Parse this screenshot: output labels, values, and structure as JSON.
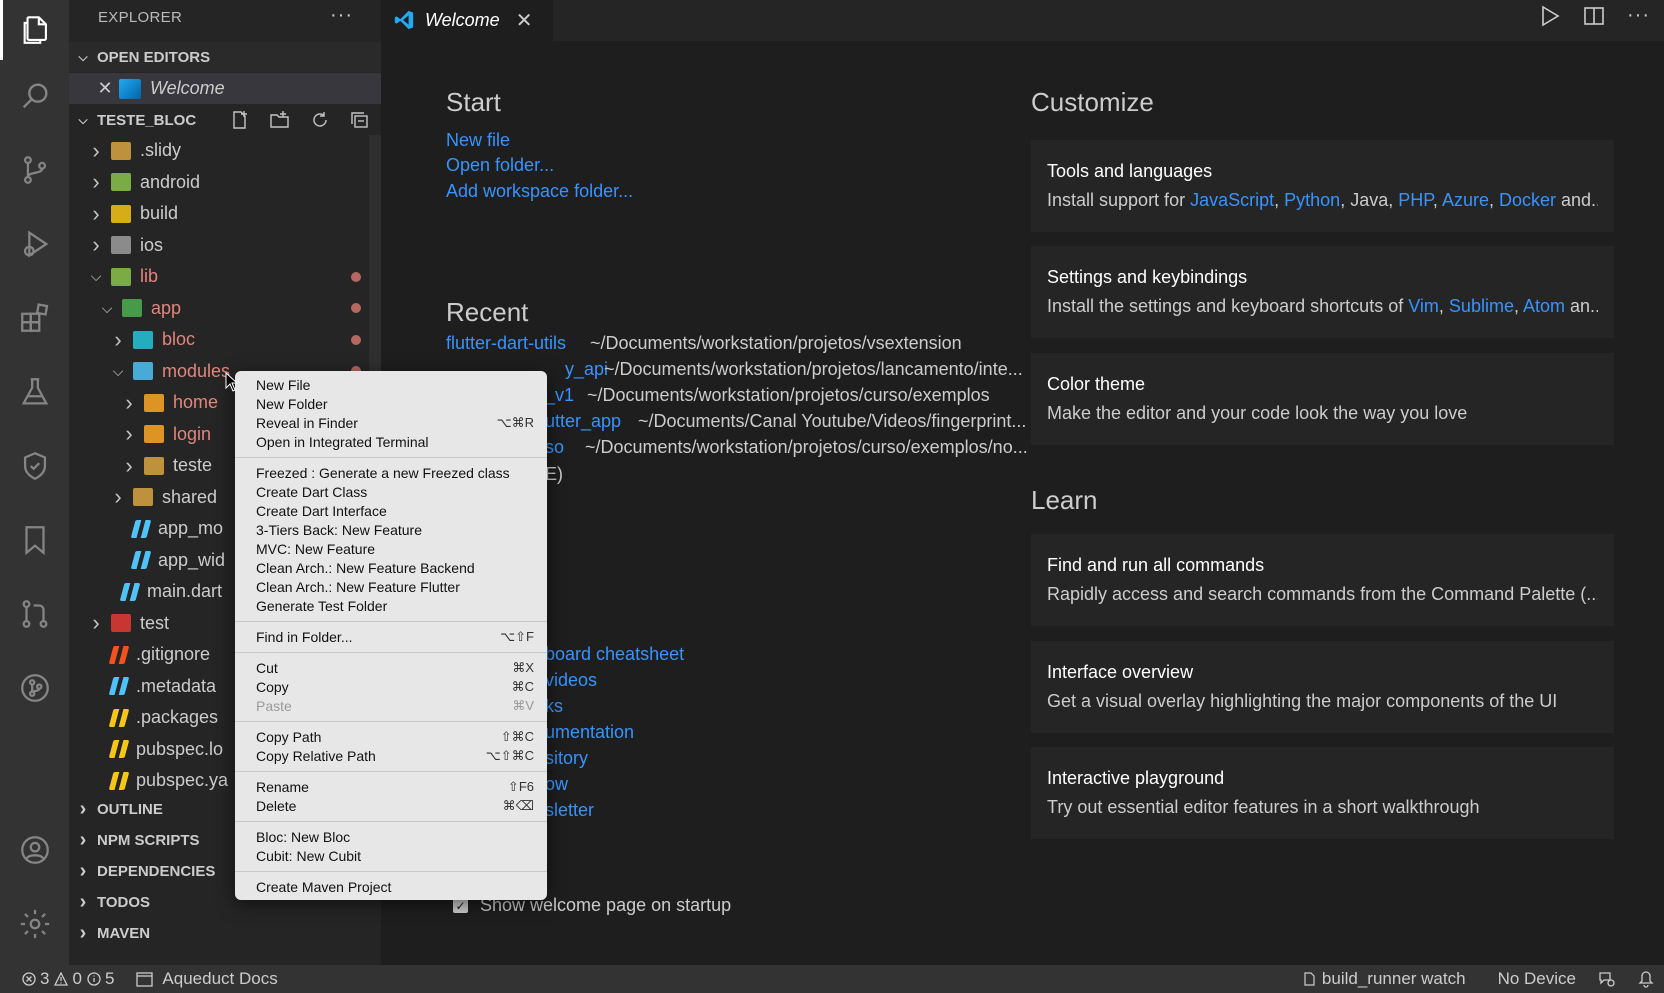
{
  "explorer": {
    "title": "EXPLORER",
    "more": "···",
    "open_editors_label": "OPEN EDITORS",
    "open_editor_file": "Welcome",
    "project_label": "TESTE_BLOC",
    "tree": [
      {
        "label": ".slidy",
        "depth": 0,
        "expanded": false,
        "icon": "folder-icon",
        "color": "#d9a441"
      },
      {
        "label": "android",
        "depth": 0,
        "expanded": false,
        "icon": "android-folder-icon",
        "color": "#8bc34a"
      },
      {
        "label": "build",
        "depth": 0,
        "expanded": false,
        "icon": "build-folder-icon",
        "color": "#f5c518"
      },
      {
        "label": "ios",
        "depth": 0,
        "expanded": false,
        "icon": "ios-folder-icon",
        "color": "#9e9e9e"
      },
      {
        "label": "lib",
        "depth": 0,
        "expanded": true,
        "icon": "lib-folder-icon",
        "color": "#8bc34a",
        "modified": true
      },
      {
        "label": "app",
        "depth": 1,
        "expanded": true,
        "icon": "app-folder-icon",
        "color": "#4caf50",
        "modified": true
      },
      {
        "label": "bloc",
        "depth": 2,
        "expanded": false,
        "icon": "bloc-folder-icon",
        "color": "#26c6da",
        "modified": true
      },
      {
        "label": "modules",
        "depth": 2,
        "expanded": true,
        "icon": "modules-folder-icon",
        "color": "#4fc3f7",
        "modified": true
      },
      {
        "label": "home",
        "depth": 3,
        "expanded": false,
        "icon": "home-folder-icon",
        "color": "#ffa726",
        "modified": true
      },
      {
        "label": "login",
        "depth": 3,
        "expanded": false,
        "icon": "login-folder-icon",
        "color": "#ffa726",
        "modified": true
      },
      {
        "label": "teste",
        "depth": 3,
        "expanded": false,
        "icon": "folder-icon",
        "color": "#d9a441"
      },
      {
        "label": "shared",
        "depth": 2,
        "expanded": false,
        "icon": "folder-icon",
        "color": "#d9a441"
      },
      {
        "label": "app_mo",
        "depth": 2,
        "file": true,
        "icon": "dart-file-icon",
        "color": "#4fc3f7"
      },
      {
        "label": "app_wid",
        "depth": 2,
        "file": true,
        "icon": "dart-file-icon",
        "color": "#4fc3f7"
      },
      {
        "label": "main.dart",
        "depth": 1,
        "file": true,
        "icon": "dart-file-icon",
        "color": "#4fc3f7"
      },
      {
        "label": "test",
        "depth": 0,
        "expanded": false,
        "icon": "test-folder-icon",
        "color": "#e53935"
      },
      {
        "label": ".gitignore",
        "depth": 0,
        "file": true,
        "icon": "git-file-icon",
        "color": "#f4511e"
      },
      {
        "label": ".metadata",
        "depth": 0,
        "file": true,
        "icon": "flutter-file-icon",
        "color": "#4fc3f7"
      },
      {
        "label": ".packages",
        "depth": 0,
        "file": true,
        "icon": "packages-file-icon",
        "color": "#f5c518"
      },
      {
        "label": "pubspec.lo",
        "depth": 0,
        "file": true,
        "icon": "yaml-file-icon",
        "color": "#f5c518"
      },
      {
        "label": "pubspec.ya",
        "depth": 0,
        "file": true,
        "icon": "yaml-file-icon",
        "color": "#f5c518"
      }
    ],
    "bottom_sections": [
      "OUTLINE",
      "NPM SCRIPTS",
      "DEPENDENCIES",
      "TODOS",
      "MAVEN"
    ]
  },
  "tab": {
    "label": "Welcome",
    "close": "✕"
  },
  "welcome": {
    "start_heading": "Start",
    "start_links": [
      "New file",
      "Open folder...",
      "Add workspace folder..."
    ],
    "recent_heading": "Recent",
    "recent": [
      {
        "name": "flutter-dart-utils",
        "path": "~/Documents/workstation/projetos/vsextension"
      },
      {
        "name": "y_api",
        "path": "~/Documents/workstation/projetos/lancamento/inte..."
      },
      {
        "name": "_v1",
        "path": "~/Documents/workstation/projetos/curso/exemplos"
      },
      {
        "name": "utter_app",
        "path": "~/Documents/Canal Youtube/Videos/fingerprint..."
      },
      {
        "name": "so",
        "path": "~/Documents/workstation/projetos/curso/exemplos/no..."
      }
    ],
    "more_fragment": "E)",
    "help_links": [
      "board cheatsheet",
      "videos",
      "ks",
      "umentation",
      "sitory",
      "ow",
      "sletter"
    ],
    "customize_heading": "Customize",
    "learn_heading": "Learn",
    "customize_cards": [
      {
        "title": "Tools and languages",
        "prefix": "Install support for ",
        "links": [
          "JavaScript",
          "Python"
        ],
        "middle": ", Java, ",
        "links2": [
          "PHP",
          "Azure",
          "Docker"
        ],
        "suffix": " and..."
      },
      {
        "title": "Settings and keybindings",
        "prefix": "Install the settings and keyboard shortcuts of ",
        "links": [
          "Vim",
          "Sublime",
          "Atom"
        ],
        "suffix": " an..."
      },
      {
        "title": "Color theme",
        "desc": "Make the editor and your code look the way you love"
      }
    ],
    "learn_cards": [
      {
        "title": "Find and run all commands",
        "desc": "Rapidly access and search commands from the Command Palette (..."
      },
      {
        "title": "Interface overview",
        "desc": "Get a visual overlay highlighting the major components of the UI"
      },
      {
        "title": "Interactive playground",
        "desc": "Try out essential editor features in a short walkthrough"
      }
    ],
    "startup_label": "Show welcome page on startup",
    "startup_checked": true
  },
  "context_menu": {
    "groups": [
      [
        {
          "label": "New File",
          "shortcut": ""
        },
        {
          "label": "New Folder",
          "shortcut": ""
        },
        {
          "label": "Reveal in Finder",
          "shortcut": "⌥⌘R"
        },
        {
          "label": "Open in Integrated Terminal",
          "shortcut": ""
        }
      ],
      [
        {
          "label": "Freezed : Generate a new Freezed class",
          "shortcut": ""
        },
        {
          "label": "Create Dart Class",
          "shortcut": ""
        },
        {
          "label": "Create Dart Interface",
          "shortcut": ""
        },
        {
          "label": "3-Tiers Back: New Feature",
          "shortcut": ""
        },
        {
          "label": "MVC: New Feature",
          "shortcut": ""
        },
        {
          "label": "Clean Arch.: New Feature Backend",
          "shortcut": ""
        },
        {
          "label": "Clean Arch.: New Feature Flutter",
          "shortcut": ""
        },
        {
          "label": "Generate Test Folder",
          "shortcut": ""
        }
      ],
      [
        {
          "label": "Find in Folder...",
          "shortcut": "⌥⇧F"
        }
      ],
      [
        {
          "label": "Cut",
          "shortcut": "⌘X"
        },
        {
          "label": "Copy",
          "shortcut": "⌘C"
        },
        {
          "label": "Paste",
          "shortcut": "⌘V",
          "disabled": true
        }
      ],
      [
        {
          "label": "Copy Path",
          "shortcut": "⇧⌘C"
        },
        {
          "label": "Copy Relative Path",
          "shortcut": "⌥⇧⌘C"
        }
      ],
      [
        {
          "label": "Rename",
          "shortcut": "⇧F6"
        },
        {
          "label": "Delete",
          "shortcut": "⌘⌫"
        }
      ],
      [
        {
          "label": "Bloc: New Bloc",
          "shortcut": ""
        },
        {
          "label": "Cubit: New Cubit",
          "shortcut": ""
        }
      ],
      [
        {
          "label": "Create Maven Project",
          "shortcut": ""
        }
      ]
    ]
  },
  "status": {
    "errors": "3",
    "warnings": "0",
    "infos": "5",
    "docs": "Aqueduct Docs",
    "runner": "build_runner watch",
    "device": "No Device"
  },
  "colors": {
    "accent_link": "#3794ff",
    "modified": "#e2857a",
    "bg": "#1e1e1e",
    "sidebar": "#252526",
    "activity": "#333333"
  }
}
